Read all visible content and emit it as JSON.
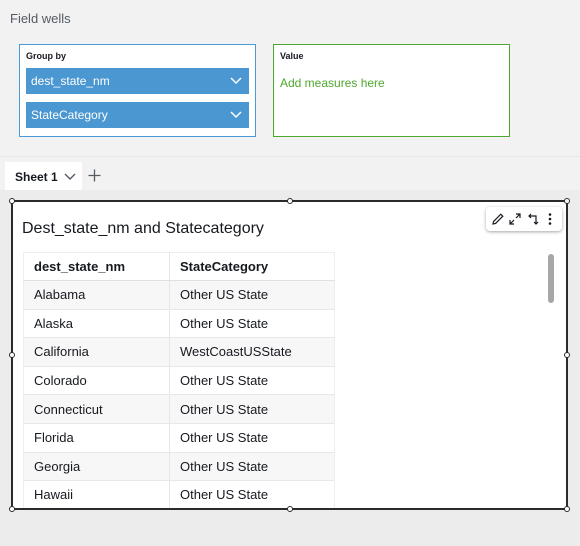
{
  "field_wells": {
    "title": "Field wells",
    "group_by": {
      "label": "Group by",
      "fields": [
        {
          "name": "dest_state_nm"
        },
        {
          "name": "StateCategory"
        }
      ]
    },
    "value": {
      "label": "Value",
      "hint": "Add measures here"
    },
    "colors": {
      "group_accent": "#4b97d1",
      "value_accent": "#4ea72e"
    }
  },
  "sheets": {
    "tabs": [
      {
        "label": "Sheet 1"
      }
    ]
  },
  "visual": {
    "title": "Dest_state_nm and Statecategory",
    "toolbar": [
      "pencil-icon",
      "expand-icon",
      "swap-icon",
      "more-icon"
    ],
    "table": {
      "columns": [
        "dest_state_nm",
        "StateCategory"
      ],
      "rows": [
        [
          "Alabama",
          "Other US State"
        ],
        [
          "Alaska",
          "Other US State"
        ],
        [
          "California",
          "WestCoastUSState"
        ],
        [
          "Colorado",
          "Other US State"
        ],
        [
          "Connecticut",
          "Other US State"
        ],
        [
          "Florida",
          "Other US State"
        ],
        [
          "Georgia",
          "Other US State"
        ],
        [
          "Hawaii",
          "Other US State"
        ]
      ]
    }
  }
}
